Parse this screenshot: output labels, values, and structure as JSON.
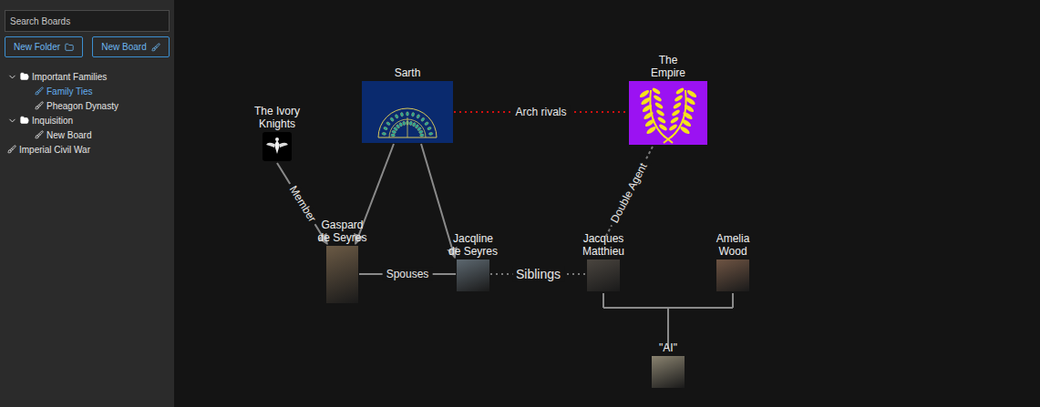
{
  "sidebar": {
    "search": {
      "placeholder": "Search Boards"
    },
    "buttons": [
      {
        "label": "New Folder",
        "icon": "folder"
      },
      {
        "label": "New Board",
        "icon": "board"
      }
    ],
    "tree": [
      {
        "label": "Important Families",
        "kind": "folder",
        "expanded": true,
        "selected": false,
        "children": [
          {
            "label": "Family Ties",
            "kind": "board",
            "selected": true
          },
          {
            "label": "Pheagon Dynasty",
            "kind": "board",
            "selected": false
          }
        ]
      },
      {
        "label": "Inquisition",
        "kind": "folder",
        "expanded": true,
        "selected": false,
        "children": [
          {
            "label": "New Board",
            "kind": "board",
            "selected": false
          }
        ]
      },
      {
        "label": "Imperial Civil War",
        "kind": "board",
        "selected": false
      }
    ]
  },
  "canvas": {
    "nodes": [
      {
        "name": "The Ivory Knights",
        "kind": "emblem",
        "color": "#000000"
      },
      {
        "name": "Sarth",
        "kind": "peacock",
        "color": "#0a2a6e"
      },
      {
        "name": "The Empire",
        "kind": "laurel",
        "color": "#9b12f2"
      },
      {
        "name": "Gaspard de Seyres",
        "kind": "portrait",
        "color": "#6b5a45"
      },
      {
        "name": "Jacqline de Seyres",
        "kind": "portrait",
        "color": "#5d6870"
      },
      {
        "name": "Jacques Matthieu",
        "kind": "portrait",
        "color": "#4a453f"
      },
      {
        "name": "Amelia Wood",
        "kind": "portrait",
        "color": "#6e5443"
      },
      {
        "name": "\"AI\"",
        "kind": "portrait",
        "color": "#8a8370"
      }
    ],
    "edges": [
      {
        "from": "The Ivory Knights",
        "to": "Gaspard de Seyres",
        "label": "Member",
        "kind": "arrow",
        "pattern": "solid",
        "color": "#8a8a8a"
      },
      {
        "from": "Sarth",
        "to": "Gaspard de Seyres",
        "kind": "arrow",
        "pattern": "solid",
        "color": "#8a8a8a"
      },
      {
        "from": "Sarth",
        "to": "Jacqline de Seyres",
        "kind": "arrow",
        "pattern": "solid",
        "color": "#8a8a8a"
      },
      {
        "from": "Sarth",
        "to": "The Empire",
        "label": "Arch rivals",
        "kind": "line",
        "pattern": "dotted",
        "color": "#d01010"
      },
      {
        "from": "The Empire",
        "to": "Jacques Matthieu",
        "label": "Double Agent",
        "kind": "line",
        "pattern": "dashed",
        "color": "#7a7a7a"
      },
      {
        "from": "Gaspard de Seyres",
        "to": "Jacqline de Seyres",
        "label": "Spouses",
        "kind": "line",
        "pattern": "solid",
        "color": "#8a8a8a"
      },
      {
        "from": "Jacqline de Seyres",
        "to": "Jacques Matthieu",
        "label": "Siblings",
        "kind": "line",
        "pattern": "dotted",
        "color": "#7a7a7a"
      }
    ],
    "families": [
      {
        "parents": [
          "Jacques Matthieu",
          "Amelia Wood"
        ],
        "child": "\"AI\""
      }
    ]
  }
}
